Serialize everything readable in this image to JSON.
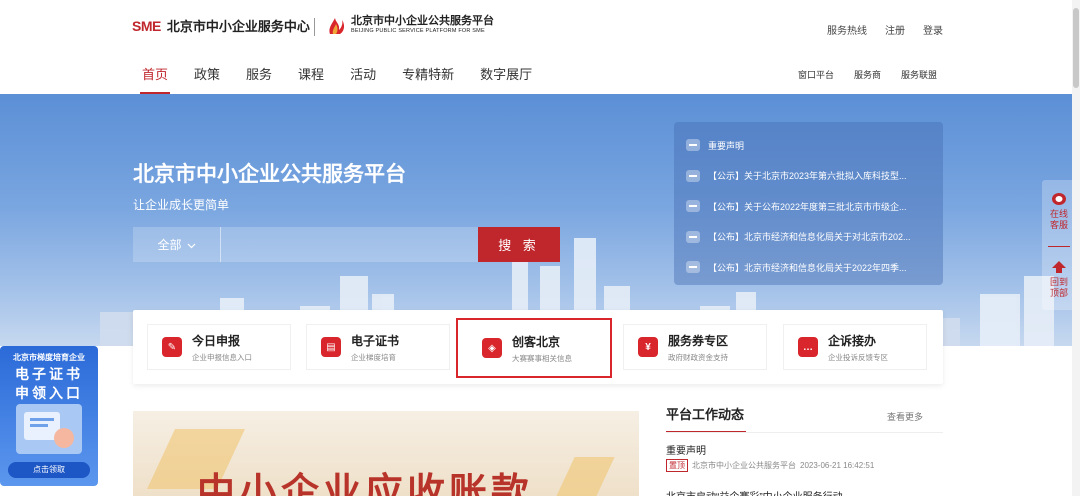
{
  "header": {
    "logo_sme": "SME",
    "org_name": "北京市中小企业服务中心",
    "platform_name": "北京市中小企业公共服务平台",
    "platform_name_en": "BEIJING PUBLIC SERVICE PLATFORM FOR SME",
    "top_links": [
      "服务热线",
      "注册",
      "登录"
    ]
  },
  "nav": {
    "items": [
      "首页",
      "政策",
      "服务",
      "课程",
      "活动",
      "专精特新",
      "数字展厅"
    ],
    "active_index": 0,
    "right_links": [
      "窗口平台",
      "服务商",
      "服务联盟"
    ]
  },
  "hero": {
    "title": "北京市中小企业公共服务平台",
    "subtitle": "让企业成长更简单",
    "search": {
      "category": "全部",
      "placeholder": "",
      "button": "搜 索"
    }
  },
  "notices": [
    "重要声明",
    "【公示】关于北京市2023年第六批拟入库科技型...",
    "【公布】关于公布2022年度第三批北京市市级企...",
    "【公布】北京市经济和信息化局关于对北京市202...",
    "【公布】北京市经济和信息化局关于2022年四季..."
  ],
  "float_right": {
    "service": "在线客服",
    "top": "回到顶部"
  },
  "cards": [
    {
      "title": "今日申报",
      "desc": "企业申报信息入口",
      "icon": "declare-icon"
    },
    {
      "title": "电子证书",
      "desc": "企业梯度培育",
      "icon": "certificate-icon"
    },
    {
      "title": "创客北京",
      "desc": "大赛赛事相关信息",
      "icon": "maker-icon"
    },
    {
      "title": "服务券专区",
      "desc": "政府财政资金支持",
      "icon": "voucher-icon"
    },
    {
      "title": "企诉接办",
      "desc": "企业投诉反馈专区",
      "icon": "complaint-icon"
    }
  ],
  "float_left": {
    "top": "北京市梯度培育企业",
    "big1": "电子证书",
    "big2": "申领入口",
    "button": "点击领取"
  },
  "banner": {
    "text": "中小企业应收账款"
  },
  "news": {
    "title": "平台工作动态",
    "more": "查看更多",
    "items": [
      {
        "title": "重要声明",
        "tag": "置顶",
        "source": "北京市中小企业公共服务平台",
        "time": "2023-06-21 16:42:51"
      },
      {
        "title": "北京市启动“益企赛彩”中小企业服务行动"
      }
    ]
  },
  "colors": {
    "accent": "#c0272d",
    "hero_blue": "#5b8fd6"
  }
}
